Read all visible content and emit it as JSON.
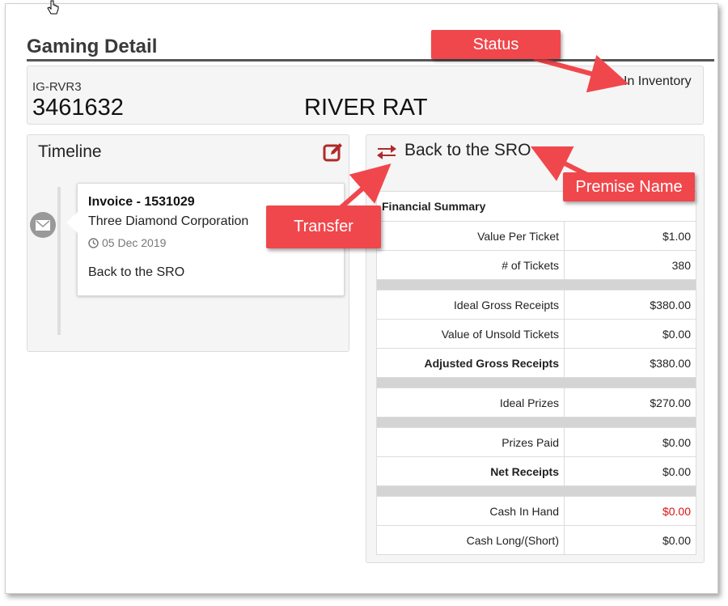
{
  "page": {
    "title": "Gaming Detail"
  },
  "header": {
    "code": "IG-RVR3",
    "number": "3461632",
    "name": "RIVER RAT",
    "status": "In Inventory"
  },
  "timeline": {
    "title": "Timeline",
    "edit_icon": "edit-square-icon",
    "event": {
      "icon": "envelope-icon",
      "title": "Invoice - 1531029",
      "company": "Three Diamond Corporation",
      "date_icon": "clock-icon",
      "date": "05 Dec 2019",
      "note": "Back to the SRO"
    }
  },
  "premise": {
    "icon": "transfer-arrows-icon",
    "name": "Back to the SRO"
  },
  "financial_summary": {
    "title": "Financial Summary",
    "rows": [
      {
        "label": "Value Per Ticket",
        "value": "$1.00"
      },
      {
        "label": "# of Tickets",
        "value": "380"
      },
      {
        "label": "Ideal Gross Receipts",
        "value": "$380.00"
      },
      {
        "label": "Value of Unsold Tickets",
        "value": "$0.00"
      },
      {
        "label": "Adjusted Gross Receipts",
        "value": "$380.00"
      },
      {
        "label": "Ideal Prizes",
        "value": "$270.00"
      },
      {
        "label": "Prizes Paid",
        "value": "$0.00"
      },
      {
        "label": "Net Receipts",
        "value": "$0.00"
      },
      {
        "label": "Cash In Hand",
        "value": "$0.00"
      },
      {
        "label": "Cash Long/(Short)",
        "value": "$0.00"
      }
    ]
  },
  "callouts": {
    "status": "Status",
    "premise": "Premise Name",
    "transfer": "Transfer"
  },
  "colors": {
    "callout": "#f0474c",
    "icon_red": "#b02a2a",
    "negative": "#dd1111"
  }
}
